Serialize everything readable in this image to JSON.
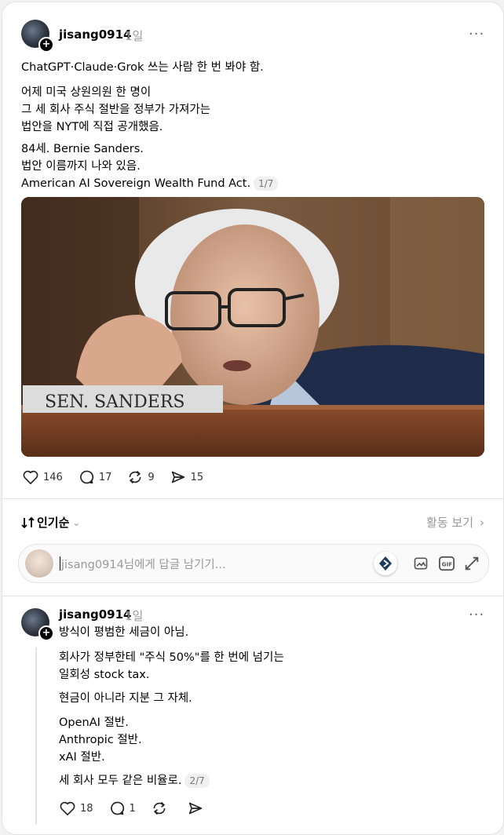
{
  "post": {
    "username": "jisang0914",
    "time": "1일",
    "more_icon": "more-icon",
    "paragraphs": [
      "ChatGPT·Claude·Grok 쓰는 사람 한 번 봐야 함.",
      "어제 미국 상원의원 한 명이\n그 세 회사 주식 절반을 정부가 가져가는\n법안을 NYT에 직접 공개했음.",
      "84세. Bernie Sanders.\n법안 이름까지 나와 있음.\nAmerican AI Sovereign Wealth Fund Act."
    ],
    "page_badge": "1/7",
    "photo_placard": "SEN. SANDERS",
    "actions": {
      "likes": "146",
      "comments": "17",
      "reposts": "9",
      "shares": "15"
    }
  },
  "sort": {
    "label": "인기순",
    "activity_label": "활동 보기"
  },
  "reply_box": {
    "placeholder": "jisang0914님에게 답글 남기기..."
  },
  "reply": {
    "username": "jisang0914",
    "time": "1일",
    "paragraphs": [
      "방식이 평범한 세금이 아님.",
      "회사가 정부한테 \"주식 50%\"를 한 번에 넘기는\n일회성 stock tax.",
      "현금이 아니라 지분 그 자체.",
      "OpenAI 절반.\nAnthropic 절반.\nxAI 절반.",
      "세 회사 모두 같은 비율로."
    ],
    "page_badge": "2/7",
    "actions": {
      "likes": "18",
      "comments": "1"
    }
  },
  "colors": {
    "accent": "#000000",
    "muted": "#999999",
    "border": "#e2e2e2"
  }
}
